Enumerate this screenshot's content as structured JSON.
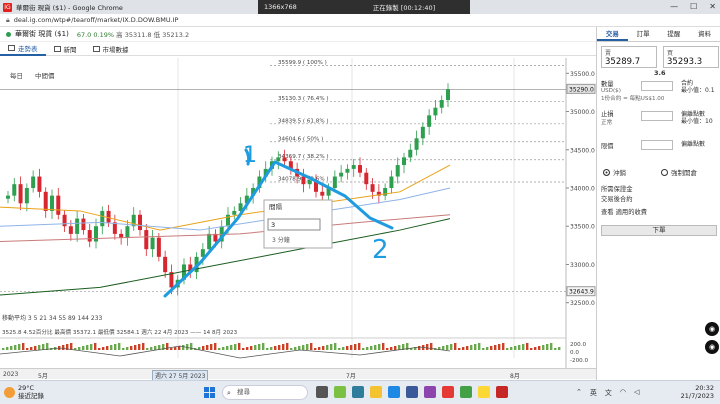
{
  "browser": {
    "title": "華爾街 現貨 ($1) - Google Chrome",
    "url": "deal.ig.com/wtp#/tearoff/market/IX.D.DOW.BMU.IP"
  },
  "recording": {
    "resolution": "1366x768",
    "status": "正在錄製 [00:12:40]"
  },
  "quote": {
    "name": "華爾街 現貨 ($1)",
    "change": "67.0",
    "change_pct": "0.19%",
    "high": "高 35311.8",
    "low": "低 35213.2"
  },
  "tabs": [
    "走勢表",
    "新聞",
    "市場數據"
  ],
  "periods": [
    "每日",
    "中間價"
  ],
  "chart_data": {
    "type": "candlestick",
    "ylim": [
      32300,
      35700
    ],
    "price_ticks": [
      "35500.0",
      "35000.0",
      "34500.0",
      "34000.0",
      "33500.0",
      "33000.0",
      "32500.0"
    ],
    "current_price": "35290.0",
    "low_marker": "32643.9",
    "fib_levels": [
      {
        "price": 35599.9,
        "label": "35599.9 ( 100% )"
      },
      {
        "price": 35130.3,
        "label": "35130.3 ( 76.4% )"
      },
      {
        "price": 34839.5,
        "label": "34839.5 ( 61.8% )"
      },
      {
        "price": 34604.6,
        "label": "34604.6 ( 50% )"
      },
      {
        "price": 34369.7,
        "label": "34369.7 ( 38.2% )"
      },
      {
        "price": 34078.9,
        "label": "34078.9 ( 23.6% )"
      }
    ],
    "date_labels": [
      "2023",
      "5月",
      "週六 27 5月 2023",
      "7月",
      "8月"
    ],
    "oscillator_ticks": [
      "200.0",
      "0.0",
      "-200.0"
    ],
    "ma_legend": "移動平均 3 5 21 34 55 89 144 233",
    "info_line": "3525.8  4.52百分比  最高價 35372.1  最低價 32584.1  週六 22 4月 2023 —— 14 8月 2023",
    "popup": {
      "title": "間隔",
      "value": "3",
      "option": "3 分鐘"
    },
    "annotations": [
      "1",
      "2"
    ]
  },
  "panel": {
    "tabs": [
      "交易",
      "訂單",
      "提醒",
      "資料"
    ],
    "sell_label": "賣",
    "sell_price": "35289.7",
    "buy_label": "買",
    "buy_price": "35293.3",
    "spread": "3.6",
    "qty_label": "數量",
    "qty_sub": "USD($)",
    "qty_note": "1份合約 = 每點US$1.00",
    "qty_right": "合約",
    "qty_right_sub": "最小值：0.1",
    "stop_label": "止損",
    "stop_sub": "正常",
    "stop_right": "偏離點數",
    "stop_right_sub": "最小值：10",
    "limit_label": "限價",
    "limit_right": "偏離點數",
    "radio_hedge": "沖銷",
    "radio_force": "強制開倉",
    "accept_text": "所需保證金",
    "accept_text2": "交易後合約",
    "view_fees": "查看 適用的收費",
    "order_button": "下單"
  },
  "taskbar": {
    "temp": "29°C",
    "weather": "接近記錄",
    "search": "搜尋",
    "ime": "英",
    "ime2": "文",
    "time": "20:32",
    "date": "21/7/2023"
  }
}
